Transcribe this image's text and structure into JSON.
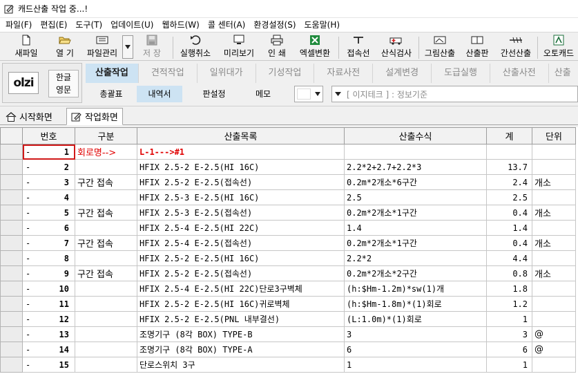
{
  "window": {
    "title": "캐드산출 작업 중...!"
  },
  "menu": [
    "파일(F)",
    "편집(E)",
    "도구(T)",
    "업데이트(U)",
    "웹하드(W)",
    "콜 센터(A)",
    "환경설정(S)",
    "도움말(H)"
  ],
  "toolbar": {
    "new": "새파일",
    "open": "열 기",
    "file_manage": "파일관리",
    "save": "저 장",
    "undo": "실행취소",
    "preview": "미리보기",
    "print": "인 쇄",
    "excel": "엑셀변환",
    "connect": "접속선",
    "formula_check": "산식검사",
    "picture_calc": "그림산출",
    "calc_board": "산출판",
    "trunk_calc": "간선산출",
    "auto_cad": "오토캐드"
  },
  "language": {
    "line1": "한글",
    "line2": "영문"
  },
  "logo": {
    "text": "olzi"
  },
  "tabs": [
    "산출작업",
    "견적작업",
    "일위대가",
    "기성작업",
    "자료사전",
    "설계변경",
    "도급실행",
    "산출사전",
    "산출"
  ],
  "subtabs": {
    "summary": "총괄표",
    "details": "내역서",
    "panel_setting": "판설정",
    "memo": "메모"
  },
  "standard_combo": "[ 이지테크 ] : 정보기준",
  "doc_tabs": {
    "home": "시작화면",
    "work": "작업화면"
  },
  "grid": {
    "headers": [
      "번호",
      "구분",
      "산출목록",
      "산출수식",
      "계",
      "단위"
    ],
    "rows": [
      {
        "mark": "-",
        "no": "1",
        "cat": "회로명-->",
        "item": "L-1--->#1",
        "formula": "",
        "total": "",
        "unit": "",
        "red": true
      },
      {
        "mark": "-",
        "no": "2",
        "cat": "",
        "item": "HFIX 2.5-2 E-2.5(HI 16C)",
        "formula": "2.2*2+2.7+2.2*3",
        "total": "13.7",
        "unit": ""
      },
      {
        "mark": "-",
        "no": "3",
        "cat": "구간 접속",
        "item": "HFIX 2.5-2 E-2.5(접속선)",
        "formula": "0.2m*2개소*6구간",
        "total": "2.4",
        "unit": "개소"
      },
      {
        "mark": "-",
        "no": "4",
        "cat": "",
        "item": "HFIX 2.5-3 E-2.5(HI 16C)",
        "formula": "2.5",
        "total": "2.5",
        "unit": ""
      },
      {
        "mark": "-",
        "no": "5",
        "cat": "구간 접속",
        "item": "HFIX 2.5-3 E-2.5(접속선)",
        "formula": "0.2m*2개소*1구간",
        "total": "0.4",
        "unit": "개소"
      },
      {
        "mark": "-",
        "no": "6",
        "cat": "",
        "item": "HFIX 2.5-4 E-2.5(HI 22C)",
        "formula": "1.4",
        "total": "1.4",
        "unit": ""
      },
      {
        "mark": "-",
        "no": "7",
        "cat": "구간 접속",
        "item": "HFIX 2.5-4 E-2.5(접속선)",
        "formula": "0.2m*2개소*1구간",
        "total": "0.4",
        "unit": "개소"
      },
      {
        "mark": "-",
        "no": "8",
        "cat": "",
        "item": "HFIX 2.5-2 E-2.5(HI 16C)",
        "formula": "2.2*2",
        "total": "4.4",
        "unit": ""
      },
      {
        "mark": "-",
        "no": "9",
        "cat": "구간 접속",
        "item": "HFIX 2.5-2 E-2.5(접속선)",
        "formula": "0.2m*2개소*2구간",
        "total": "0.8",
        "unit": "개소"
      },
      {
        "mark": "-",
        "no": "10",
        "cat": "",
        "item": "HFIX 2.5-4 E-2.5(HI 22C)단로3구벽체",
        "formula": "(h:$Hm-1.2m)*sw(1)개",
        "total": "1.8",
        "unit": ""
      },
      {
        "mark": "-",
        "no": "11",
        "cat": "",
        "item": "HFIX 2.5-2 E-2.5(HI 16C)귀로벽체",
        "formula": "(h:$Hm-1.8m)*(1)회로",
        "total": "1.2",
        "unit": ""
      },
      {
        "mark": "-",
        "no": "12",
        "cat": "",
        "item": "HFIX 2.5-2 E-2.5(PNL 내부결선)",
        "formula": "(L:1.0m)*(1)회로",
        "total": "1",
        "unit": ""
      },
      {
        "mark": "-",
        "no": "13",
        "cat": "",
        "item": "조명기구 (8각 BOX) TYPE-B",
        "formula": "3",
        "total": "3",
        "unit": "@"
      },
      {
        "mark": "-",
        "no": "14",
        "cat": "",
        "item": "조명기구 (8각 BOX) TYPE-A",
        "formula": "6",
        "total": "6",
        "unit": "@"
      },
      {
        "mark": "-",
        "no": "15",
        "cat": "",
        "item": "단로스위치 3구",
        "formula": "1",
        "total": "1",
        "unit": ""
      }
    ]
  },
  "colors": {
    "active_tab": "#cde3f3",
    "red_text": "#e00000",
    "grid_line": "#c6c6c6"
  }
}
